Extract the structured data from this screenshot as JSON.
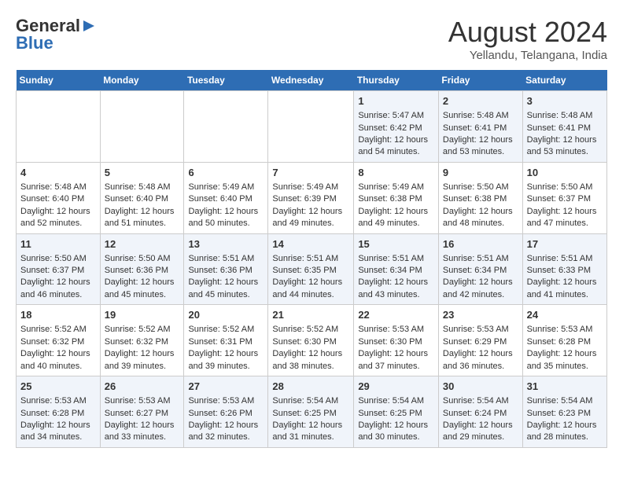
{
  "header": {
    "logo_general": "General",
    "logo_blue": "Blue",
    "month_title": "August 2024",
    "location": "Yellandu, Telangana, India"
  },
  "days_of_week": [
    "Sunday",
    "Monday",
    "Tuesday",
    "Wednesday",
    "Thursday",
    "Friday",
    "Saturday"
  ],
  "weeks": [
    [
      {
        "day": "",
        "content": ""
      },
      {
        "day": "",
        "content": ""
      },
      {
        "day": "",
        "content": ""
      },
      {
        "day": "",
        "content": ""
      },
      {
        "day": "1",
        "content": "Sunrise: 5:47 AM\nSunset: 6:42 PM\nDaylight: 12 hours\nand 54 minutes."
      },
      {
        "day": "2",
        "content": "Sunrise: 5:48 AM\nSunset: 6:41 PM\nDaylight: 12 hours\nand 53 minutes."
      },
      {
        "day": "3",
        "content": "Sunrise: 5:48 AM\nSunset: 6:41 PM\nDaylight: 12 hours\nand 53 minutes."
      }
    ],
    [
      {
        "day": "4",
        "content": "Sunrise: 5:48 AM\nSunset: 6:40 PM\nDaylight: 12 hours\nand 52 minutes."
      },
      {
        "day": "5",
        "content": "Sunrise: 5:48 AM\nSunset: 6:40 PM\nDaylight: 12 hours\nand 51 minutes."
      },
      {
        "day": "6",
        "content": "Sunrise: 5:49 AM\nSunset: 6:40 PM\nDaylight: 12 hours\nand 50 minutes."
      },
      {
        "day": "7",
        "content": "Sunrise: 5:49 AM\nSunset: 6:39 PM\nDaylight: 12 hours\nand 49 minutes."
      },
      {
        "day": "8",
        "content": "Sunrise: 5:49 AM\nSunset: 6:38 PM\nDaylight: 12 hours\nand 49 minutes."
      },
      {
        "day": "9",
        "content": "Sunrise: 5:50 AM\nSunset: 6:38 PM\nDaylight: 12 hours\nand 48 minutes."
      },
      {
        "day": "10",
        "content": "Sunrise: 5:50 AM\nSunset: 6:37 PM\nDaylight: 12 hours\nand 47 minutes."
      }
    ],
    [
      {
        "day": "11",
        "content": "Sunrise: 5:50 AM\nSunset: 6:37 PM\nDaylight: 12 hours\nand 46 minutes."
      },
      {
        "day": "12",
        "content": "Sunrise: 5:50 AM\nSunset: 6:36 PM\nDaylight: 12 hours\nand 45 minutes."
      },
      {
        "day": "13",
        "content": "Sunrise: 5:51 AM\nSunset: 6:36 PM\nDaylight: 12 hours\nand 45 minutes."
      },
      {
        "day": "14",
        "content": "Sunrise: 5:51 AM\nSunset: 6:35 PM\nDaylight: 12 hours\nand 44 minutes."
      },
      {
        "day": "15",
        "content": "Sunrise: 5:51 AM\nSunset: 6:34 PM\nDaylight: 12 hours\nand 43 minutes."
      },
      {
        "day": "16",
        "content": "Sunrise: 5:51 AM\nSunset: 6:34 PM\nDaylight: 12 hours\nand 42 minutes."
      },
      {
        "day": "17",
        "content": "Sunrise: 5:51 AM\nSunset: 6:33 PM\nDaylight: 12 hours\nand 41 minutes."
      }
    ],
    [
      {
        "day": "18",
        "content": "Sunrise: 5:52 AM\nSunset: 6:32 PM\nDaylight: 12 hours\nand 40 minutes."
      },
      {
        "day": "19",
        "content": "Sunrise: 5:52 AM\nSunset: 6:32 PM\nDaylight: 12 hours\nand 39 minutes."
      },
      {
        "day": "20",
        "content": "Sunrise: 5:52 AM\nSunset: 6:31 PM\nDaylight: 12 hours\nand 39 minutes."
      },
      {
        "day": "21",
        "content": "Sunrise: 5:52 AM\nSunset: 6:30 PM\nDaylight: 12 hours\nand 38 minutes."
      },
      {
        "day": "22",
        "content": "Sunrise: 5:53 AM\nSunset: 6:30 PM\nDaylight: 12 hours\nand 37 minutes."
      },
      {
        "day": "23",
        "content": "Sunrise: 5:53 AM\nSunset: 6:29 PM\nDaylight: 12 hours\nand 36 minutes."
      },
      {
        "day": "24",
        "content": "Sunrise: 5:53 AM\nSunset: 6:28 PM\nDaylight: 12 hours\nand 35 minutes."
      }
    ],
    [
      {
        "day": "25",
        "content": "Sunrise: 5:53 AM\nSunset: 6:28 PM\nDaylight: 12 hours\nand 34 minutes."
      },
      {
        "day": "26",
        "content": "Sunrise: 5:53 AM\nSunset: 6:27 PM\nDaylight: 12 hours\nand 33 minutes."
      },
      {
        "day": "27",
        "content": "Sunrise: 5:53 AM\nSunset: 6:26 PM\nDaylight: 12 hours\nand 32 minutes."
      },
      {
        "day": "28",
        "content": "Sunrise: 5:54 AM\nSunset: 6:25 PM\nDaylight: 12 hours\nand 31 minutes."
      },
      {
        "day": "29",
        "content": "Sunrise: 5:54 AM\nSunset: 6:25 PM\nDaylight: 12 hours\nand 30 minutes."
      },
      {
        "day": "30",
        "content": "Sunrise: 5:54 AM\nSunset: 6:24 PM\nDaylight: 12 hours\nand 29 minutes."
      },
      {
        "day": "31",
        "content": "Sunrise: 5:54 AM\nSunset: 6:23 PM\nDaylight: 12 hours\nand 28 minutes."
      }
    ]
  ]
}
